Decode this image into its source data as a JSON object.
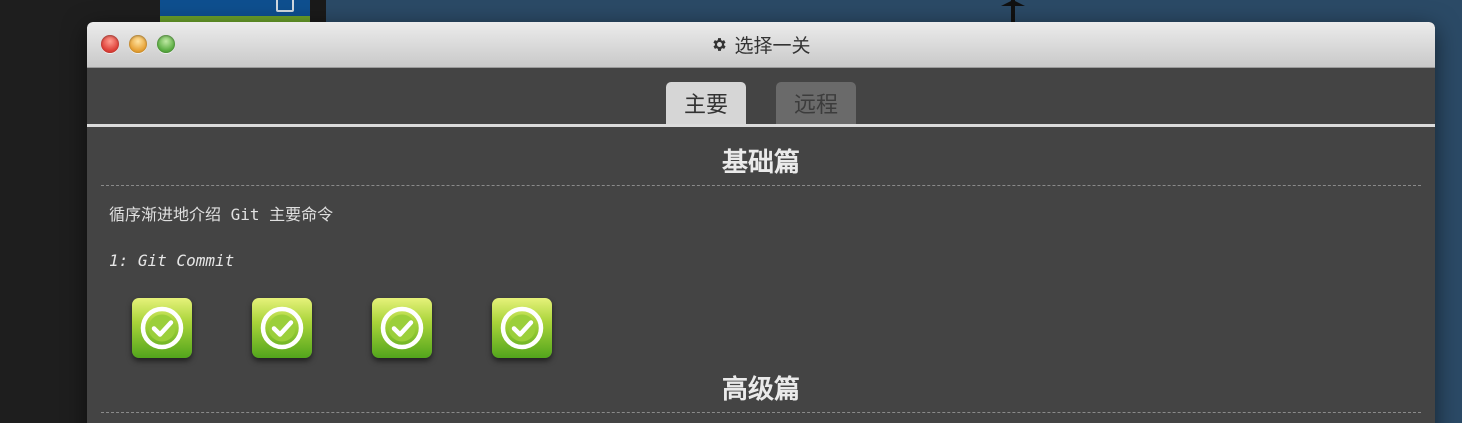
{
  "window": {
    "title": "选择一关",
    "title_icon": "gear-icon"
  },
  "tabs": [
    {
      "label": "主要",
      "active": true
    },
    {
      "label": "远程",
      "active": false
    }
  ],
  "sections": {
    "basic": {
      "title": "基础篇",
      "description": "循序渐进地介绍 Git 主要命令",
      "selected_level": "1: Git Commit",
      "levels_completed": [
        true,
        true,
        true,
        true
      ]
    },
    "advanced": {
      "title": "高级篇"
    }
  },
  "colors": {
    "window_bg": "#444444",
    "titlebar": "#d8d8d8",
    "active_tab": "#d6d6d6",
    "inactive_tab": "#6a6a6a",
    "level_complete": "#7cc12c",
    "background_canvas": "#2b4a66"
  }
}
